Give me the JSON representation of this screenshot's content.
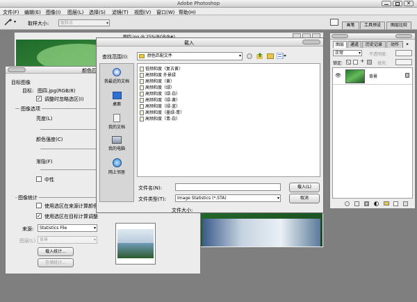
{
  "titlebar": {
    "title": "Adobe Photoshop"
  },
  "menu": [
    "文件(F)",
    "编辑(E)",
    "图像(I)",
    "图层(L)",
    "选择(S)",
    "滤镜(T)",
    "视图(V)",
    "窗口(W)",
    "帮助(H)"
  ],
  "options_bar": {
    "sample_label": "取样大小:",
    "sample_value": "取样点",
    "panel_tabs": [
      "画笔",
      "工具预设",
      "图层比较"
    ]
  },
  "document": {
    "title": "图四.jpg @ 25%(RGB/8#)"
  },
  "match_color": {
    "title": "颜色匹配",
    "target_section": "目标图像",
    "target_label": "目标:",
    "target_value": "图四.jpg(RGB/8)",
    "ignore_selection": "调整时忽略选区(I)",
    "image_options": "图像选项",
    "luminance": "亮度(L)",
    "intensity": "颜色强度(C)",
    "fade": "渐隐(F)",
    "neutralize": "中性",
    "stats_section": "图像统计",
    "use_source_selection": "使用选区在来源计算颜色",
    "use_target_selection": "使用选区在目标计算调整",
    "source_label": "来源:",
    "source_value": "Statistics File",
    "layer_label": "图层(L)",
    "layer_value": "背景",
    "load_button": "载入统计...",
    "save_button": "存储统计..."
  },
  "load_dialog": {
    "title": "载入",
    "lookin_label": "查找范围(I):",
    "lookin_value": "颜色匹配文件",
    "places": [
      {
        "label": "我最近的文档",
        "icon": "recent-documents-icon"
      },
      {
        "label": "桌面",
        "icon": "desktop-icon"
      },
      {
        "label": "我的文档",
        "icon": "my-documents-icon"
      },
      {
        "label": "我的电脑",
        "icon": "my-computer-icon"
      },
      {
        "label": "网上邻居",
        "icon": "network-places-icon"
      }
    ],
    "files": [
      "低频和度（复古黄）",
      "高频和度 外景绿",
      "高频和度（黄）",
      "高频和度（绿）",
      "高频和度（绿-白）",
      "高频和度（绿-黄）",
      "高频和度（绿-蓝）",
      "高频和度（墨绿-青）",
      "高频和度（青-白）"
    ],
    "filename_label": "文件名(N):",
    "filename_value": "",
    "filetype_label": "文件类型(T):",
    "filetype_value": "Image Statistics (*.STA)",
    "filesize_label": "文件大小:",
    "load_button": "载入(L)",
    "cancel_button": "取消"
  },
  "layers_panel": {
    "tabs": [
      "图层",
      "通道",
      "历史记录",
      "动作"
    ],
    "blend_mode": "正常",
    "opacity_label": "不透明度:",
    "lock_label": "锁定:",
    "fill_label": "填充:",
    "layer_name": "背景"
  }
}
